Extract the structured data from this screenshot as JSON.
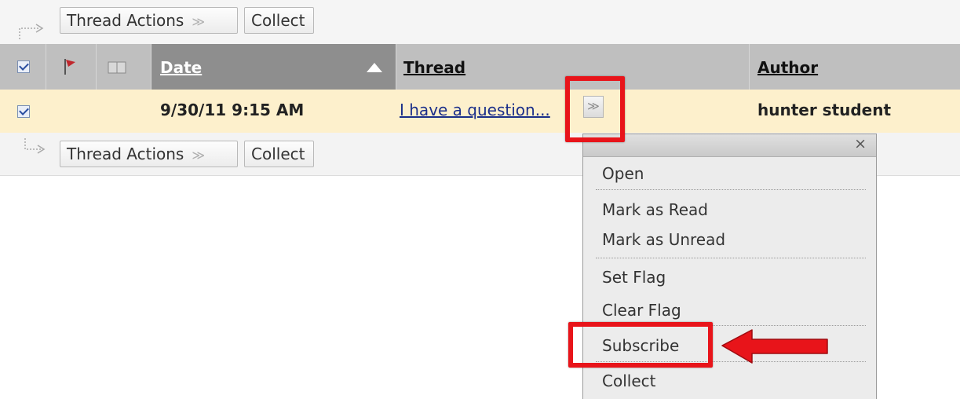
{
  "top_actionbar": {
    "thread_actions_label": "Thread Actions",
    "collect_label": "Collect"
  },
  "bottom_actionbar": {
    "thread_actions_label": "Thread Actions",
    "collect_label": "Collect"
  },
  "table": {
    "columns": {
      "date": "Date",
      "thread": "Thread",
      "author": "Author"
    },
    "rows": [
      {
        "selected": true,
        "date": "9/30/11 9:15 AM",
        "thread": "I have a question...",
        "author": "hunter student"
      }
    ]
  },
  "context_menu": {
    "close_label": "×",
    "items": [
      "Open",
      "Mark as Read",
      "Mark as Unread",
      "Set Flag",
      "Clear Flag",
      "Subscribe",
      "Collect"
    ]
  },
  "colors": {
    "highlight": "#e8141a",
    "row_highlight": "#fdf0cc",
    "header_gray": "#bfbfbf",
    "sorted_column": "#8e8e8e",
    "link": "#1b2f8a"
  }
}
